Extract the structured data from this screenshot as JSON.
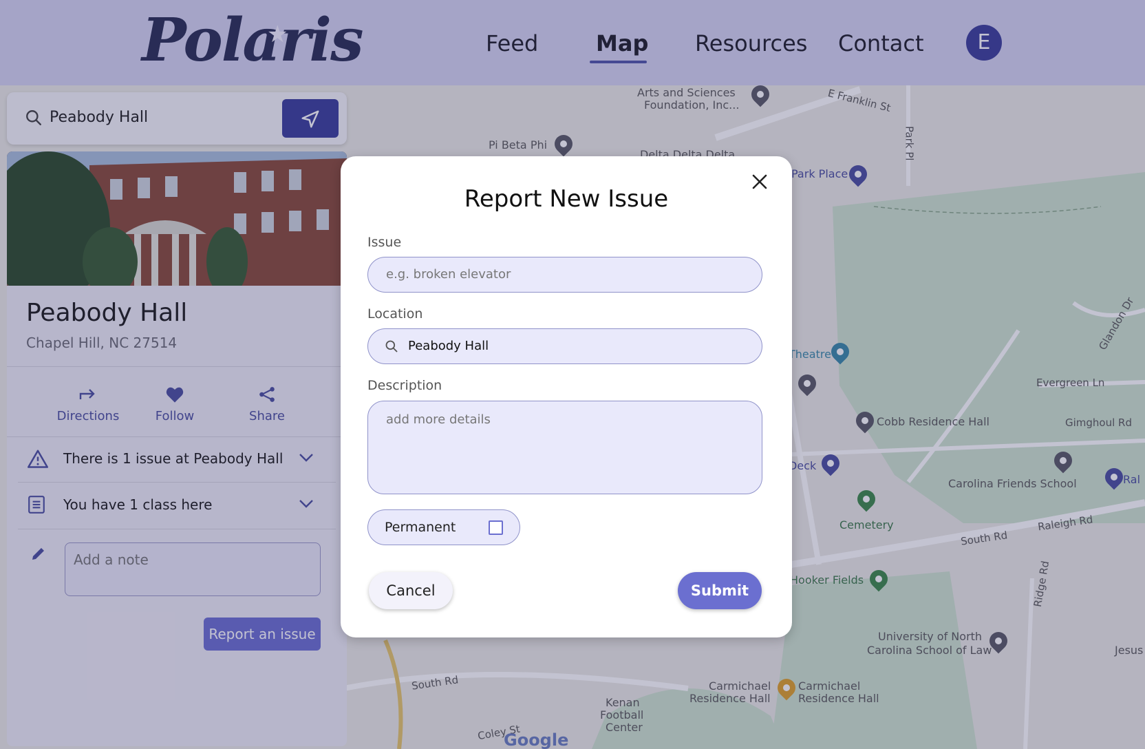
{
  "header": {
    "logo": "Polaris",
    "nav": [
      "Feed",
      "Map",
      "Resources",
      "Contact"
    ],
    "active_nav": "Map",
    "avatar_initial": "E"
  },
  "search": {
    "value": "Peabody Hall",
    "icon": "search-icon",
    "go_icon": "navigate-arrow-icon"
  },
  "place": {
    "name": "Peabody Hall",
    "address": "Chapel Hill, NC 27514",
    "actions": [
      {
        "label": "Directions",
        "icon": "directions-arrow-icon"
      },
      {
        "label": "Follow",
        "icon": "heart-icon"
      },
      {
        "label": "Share",
        "icon": "share-icon"
      }
    ],
    "issues_row": "There is 1 issue at Peabody Hall",
    "class_row": "You have 1 class here",
    "note_placeholder": "Add a note",
    "report_button": "Report an issue"
  },
  "map": {
    "labels": [
      "Arts and Sciences",
      "Foundation, Inc...",
      "E Franklin St",
      "Pi Beta Phi",
      "Delta Delta Delta",
      "Park Place",
      "Park Pl",
      "Theatre",
      "Evergreen Ln",
      "Glandon Dr",
      "Cobb Residence Hall",
      "Gimghoul Rd",
      "Deck",
      "Carolina Friends School",
      "Ral",
      "Cemetery",
      "Raleigh Rd",
      "South Rd",
      "Hooker Fields",
      "Ridge Rd",
      "University of North",
      "Carolina School of Law",
      "Jesus C",
      "Carmichael",
      "Residence Hall",
      "Kenan",
      "Football",
      "Center",
      "Coley St",
      "Google"
    ]
  },
  "modal": {
    "title": "Report New Issue",
    "issue_label": "Issue",
    "issue_placeholder": "e.g. broken elevator",
    "location_label": "Location",
    "location_value": "Peabody Hall",
    "description_label": "Description",
    "description_placeholder": "add more details",
    "permanent_label": "Permanent",
    "permanent_checked": false,
    "cancel": "Cancel",
    "submit": "Submit"
  },
  "colors": {
    "header_bg": "#d6d5f2",
    "primary": "#6b6fd0",
    "dark_primary": "#3b3f9b",
    "field_bg": "#e9e9fb"
  }
}
